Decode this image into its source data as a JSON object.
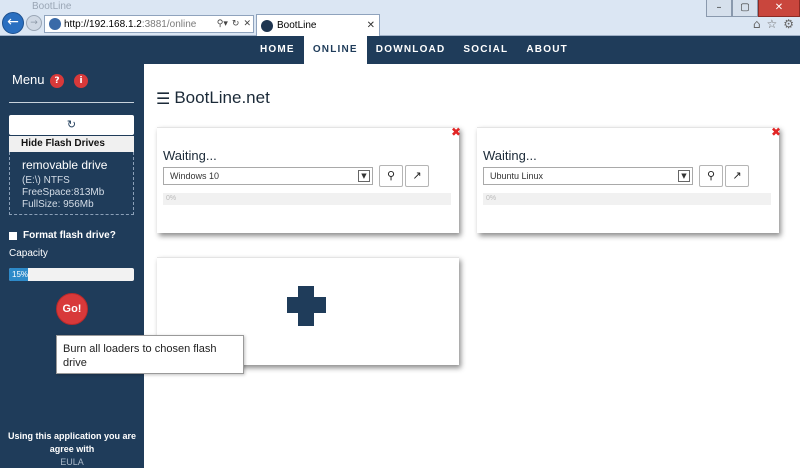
{
  "browser": {
    "ghost_tab_title": "BootLine",
    "url_host": "http://192.168.1.2",
    "url_rest": ":3881/online",
    "tab_title": "BootLine"
  },
  "nav": {
    "items": [
      {
        "label": "HOME"
      },
      {
        "label": "ONLINE"
      },
      {
        "label": "DOWNLOAD"
      },
      {
        "label": "SOCIAL"
      },
      {
        "label": "ABOUT"
      }
    ],
    "active": "ONLINE"
  },
  "sidebar": {
    "menu_title": "Menu",
    "help_icon": "?",
    "info_icon": "i",
    "hide_button": "Hide Flash Drives",
    "drive": {
      "title": "removable drive",
      "fs": "(E:\\) NTFS",
      "free": "FreeSpace:813Mb",
      "full": "FullSize: 956Mb"
    },
    "format_label": "Format flash drive?",
    "capacity_label": "Capacity",
    "capacity_text": "15%",
    "capacity_value": 0.15,
    "go_label": "Go!",
    "footer_text": "Using this application you are agree with",
    "footer_link": "EULA"
  },
  "main": {
    "title": "BootLine.net",
    "cards": [
      {
        "status": "Waiting...",
        "selected": "Windows 10",
        "progress_text": "0%"
      },
      {
        "status": "Waiting...",
        "selected": "Ubuntu Linux",
        "progress_text": "0%"
      }
    ]
  },
  "tooltip": {
    "text": "Burn all loaders to chosen flash drive"
  },
  "colors": {
    "navy": "#1f3c5a",
    "red": "#d8393a",
    "blue": "#2d8ac9"
  }
}
